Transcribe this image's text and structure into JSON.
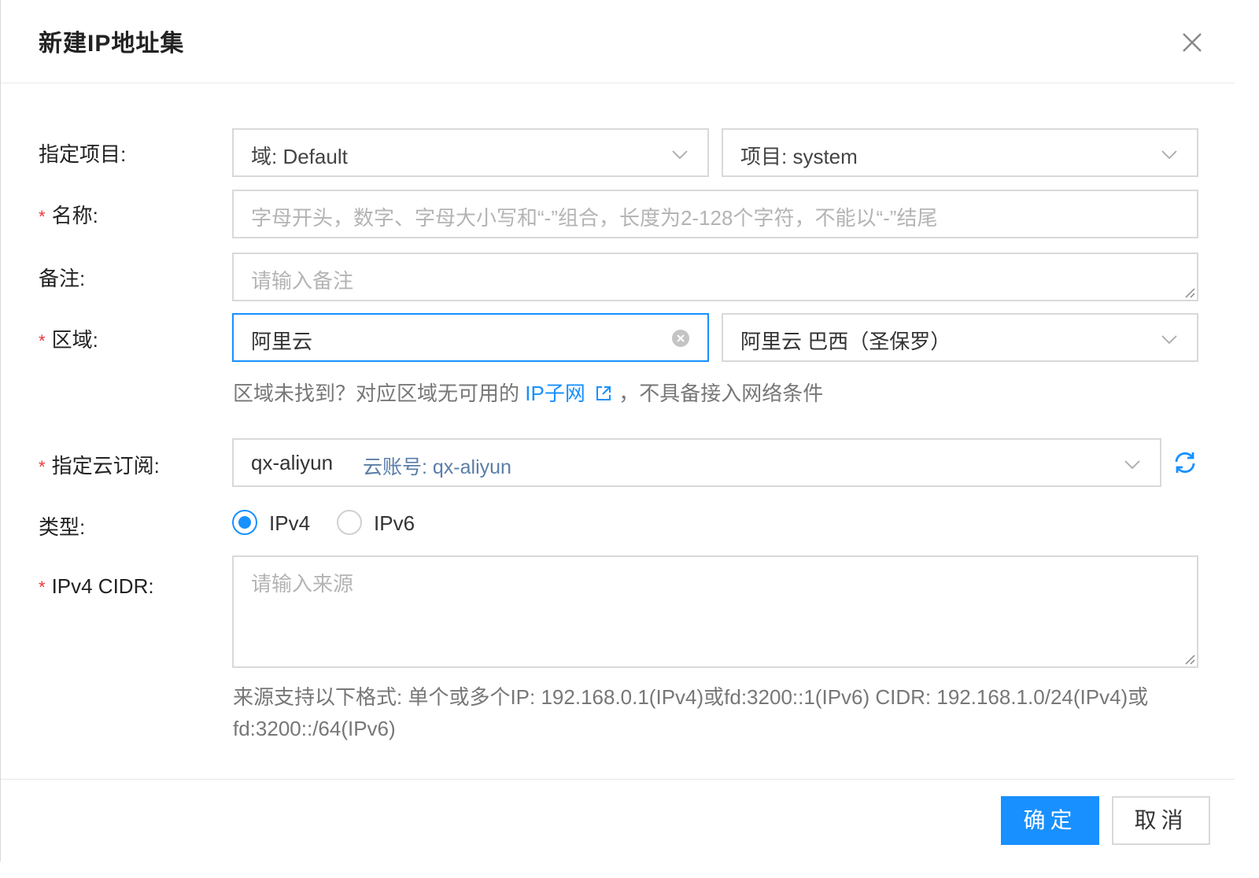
{
  "dialog": {
    "title": "新建IP地址集"
  },
  "form": {
    "project": {
      "label": "指定项目:",
      "domain_value": "域: Default",
      "project_value": "项目: system"
    },
    "name": {
      "required_mark": "*",
      "label": "名称:",
      "placeholder": "字母开头，数字、字母大小写和“-”组合，长度为2-128个字符，不能以“-”结尾"
    },
    "remark": {
      "label": "备注:",
      "placeholder": "请输入备注"
    },
    "region": {
      "required_mark": "*",
      "label": "区域:",
      "provider_value": "阿里云",
      "region_value": "阿里云 巴西（圣保罗）",
      "hint_prefix": "区域未找到？对应区域无可用的",
      "hint_link": "IP子网",
      "hint_suffix": "，不具备接入网络条件"
    },
    "subscription": {
      "required_mark": "*",
      "label": "指定云订阅:",
      "value": "qx-aliyun",
      "account": "云账号: qx-aliyun"
    },
    "type": {
      "label": "类型:",
      "options": [
        "IPv4",
        "IPv6"
      ],
      "selected": "IPv4"
    },
    "cidr": {
      "required_mark": "*",
      "label": "IPv4 CIDR:",
      "placeholder": "请输入来源",
      "hint_line1": "来源支持以下格式: 单个或多个IP: 192.168.0.1(IPv4)或fd:3200::1(IPv6) CIDR: 192.168.1.0/24(IPv4)或",
      "hint_line2": "fd:3200::/64(IPv6)"
    }
  },
  "buttons": {
    "confirm": "确定",
    "cancel": "取消"
  },
  "colors": {
    "primary": "#1890ff",
    "required": "#e4393c",
    "border": "#d9d9d9"
  }
}
